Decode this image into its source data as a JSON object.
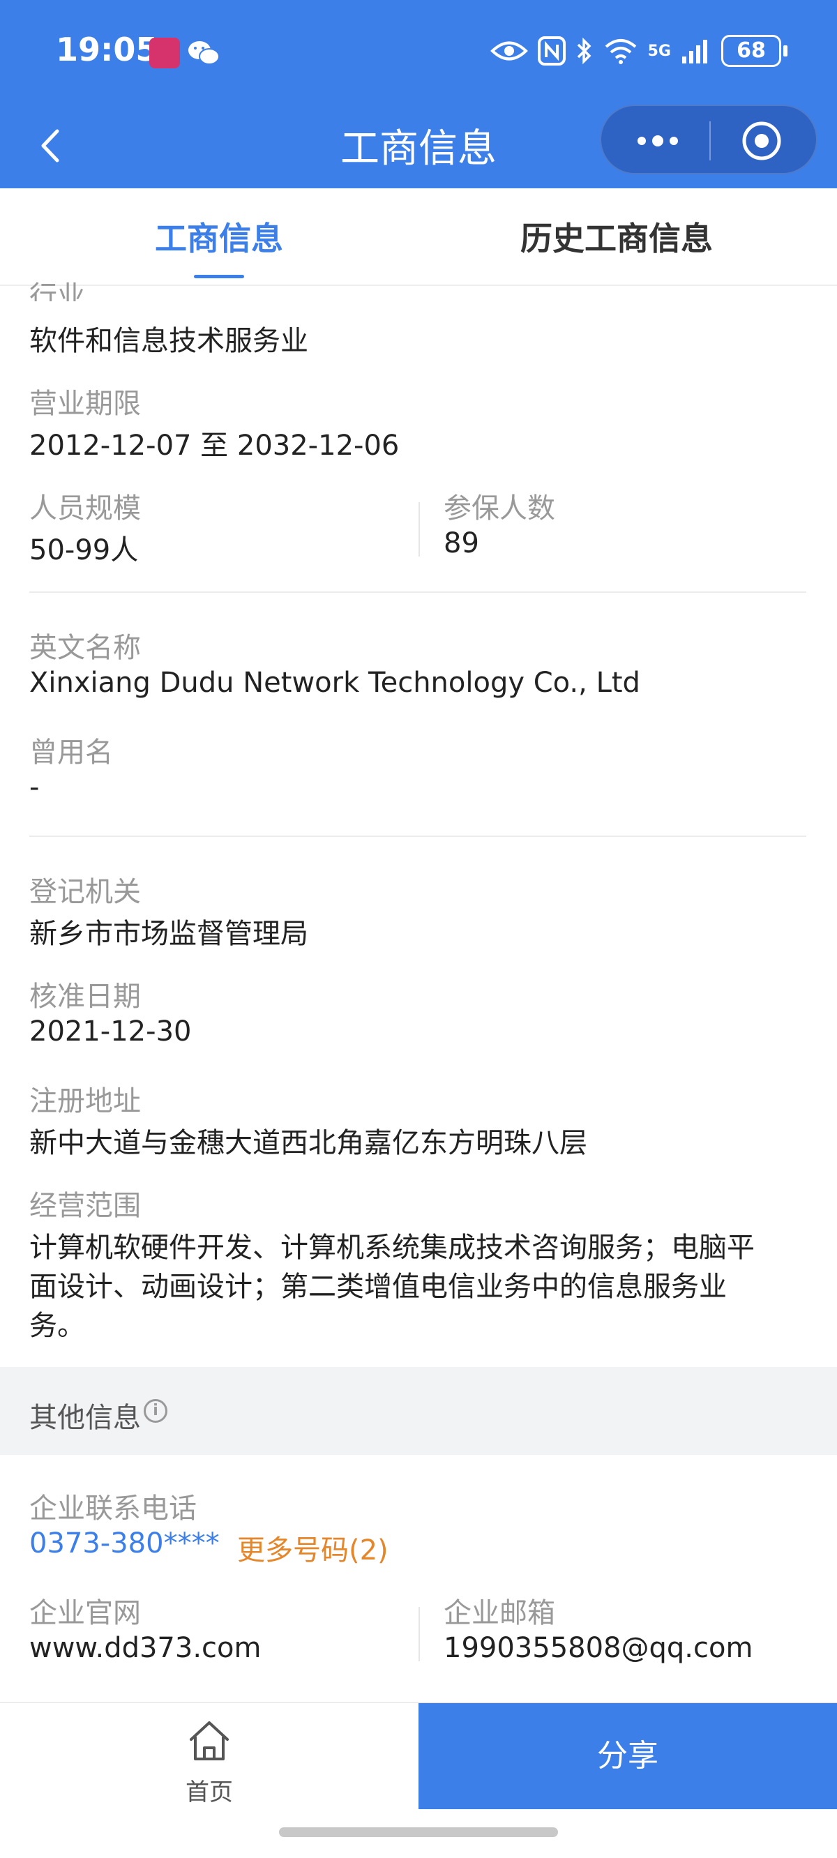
{
  "status_bar": {
    "time": "19:05",
    "battery": "68",
    "network": "5G",
    "icons": [
      "eye-icon",
      "nfc-icon",
      "bluetooth-icon",
      "wifi-icon",
      "signal-icon"
    ]
  },
  "navbar": {
    "title": "工商信息"
  },
  "tabs": [
    {
      "label": "工商信息",
      "active": true
    },
    {
      "label": "历史工商信息",
      "active": false
    }
  ],
  "fields": {
    "industry": {
      "label": "行业",
      "value": "软件和信息技术服务业"
    },
    "business_term": {
      "label": "营业期限",
      "value": "2012-12-07 至 2032-12-06"
    },
    "staff_size": {
      "label": "人员规模",
      "value": "50-99人"
    },
    "insured_count": {
      "label": "参保人数",
      "value": "89"
    },
    "english_name": {
      "label": "英文名称",
      "value": "Xinxiang Dudu Network Technology Co., Ltd"
    },
    "former_name": {
      "label": "曾用名",
      "value": "-"
    },
    "registration_authority": {
      "label": "登记机关",
      "value": "新乡市市场监督管理局"
    },
    "approval_date": {
      "label": "核准日期",
      "value": "2021-12-30"
    },
    "registered_address": {
      "label": "注册地址",
      "value": "新中大道与金穗大道西北角嘉亿东方明珠八层"
    },
    "business_scope": {
      "label": "经营范围",
      "lines": [
        "计算机软硬件开发、计算机系统集成技术咨询服务；电脑平",
        "面设计、动画设计；第二类增值电信业务中的信息服务业",
        "务。"
      ]
    }
  },
  "other_info": {
    "section_title": "其他信息",
    "phone": {
      "label": "企业联系电话",
      "value": "0373-380****",
      "more": "更多号码(2)"
    },
    "website": {
      "label": "企业官网",
      "value": "www.dd373.com"
    },
    "email": {
      "label": "企业邮箱",
      "value": "1990355808@qq.com"
    }
  },
  "bottom_bar": {
    "home_label": "首页",
    "share_label": "分享"
  },
  "colors": {
    "primary": "#3d7fe8",
    "link_orange": "#e5862a",
    "label_gray": "#999999"
  }
}
